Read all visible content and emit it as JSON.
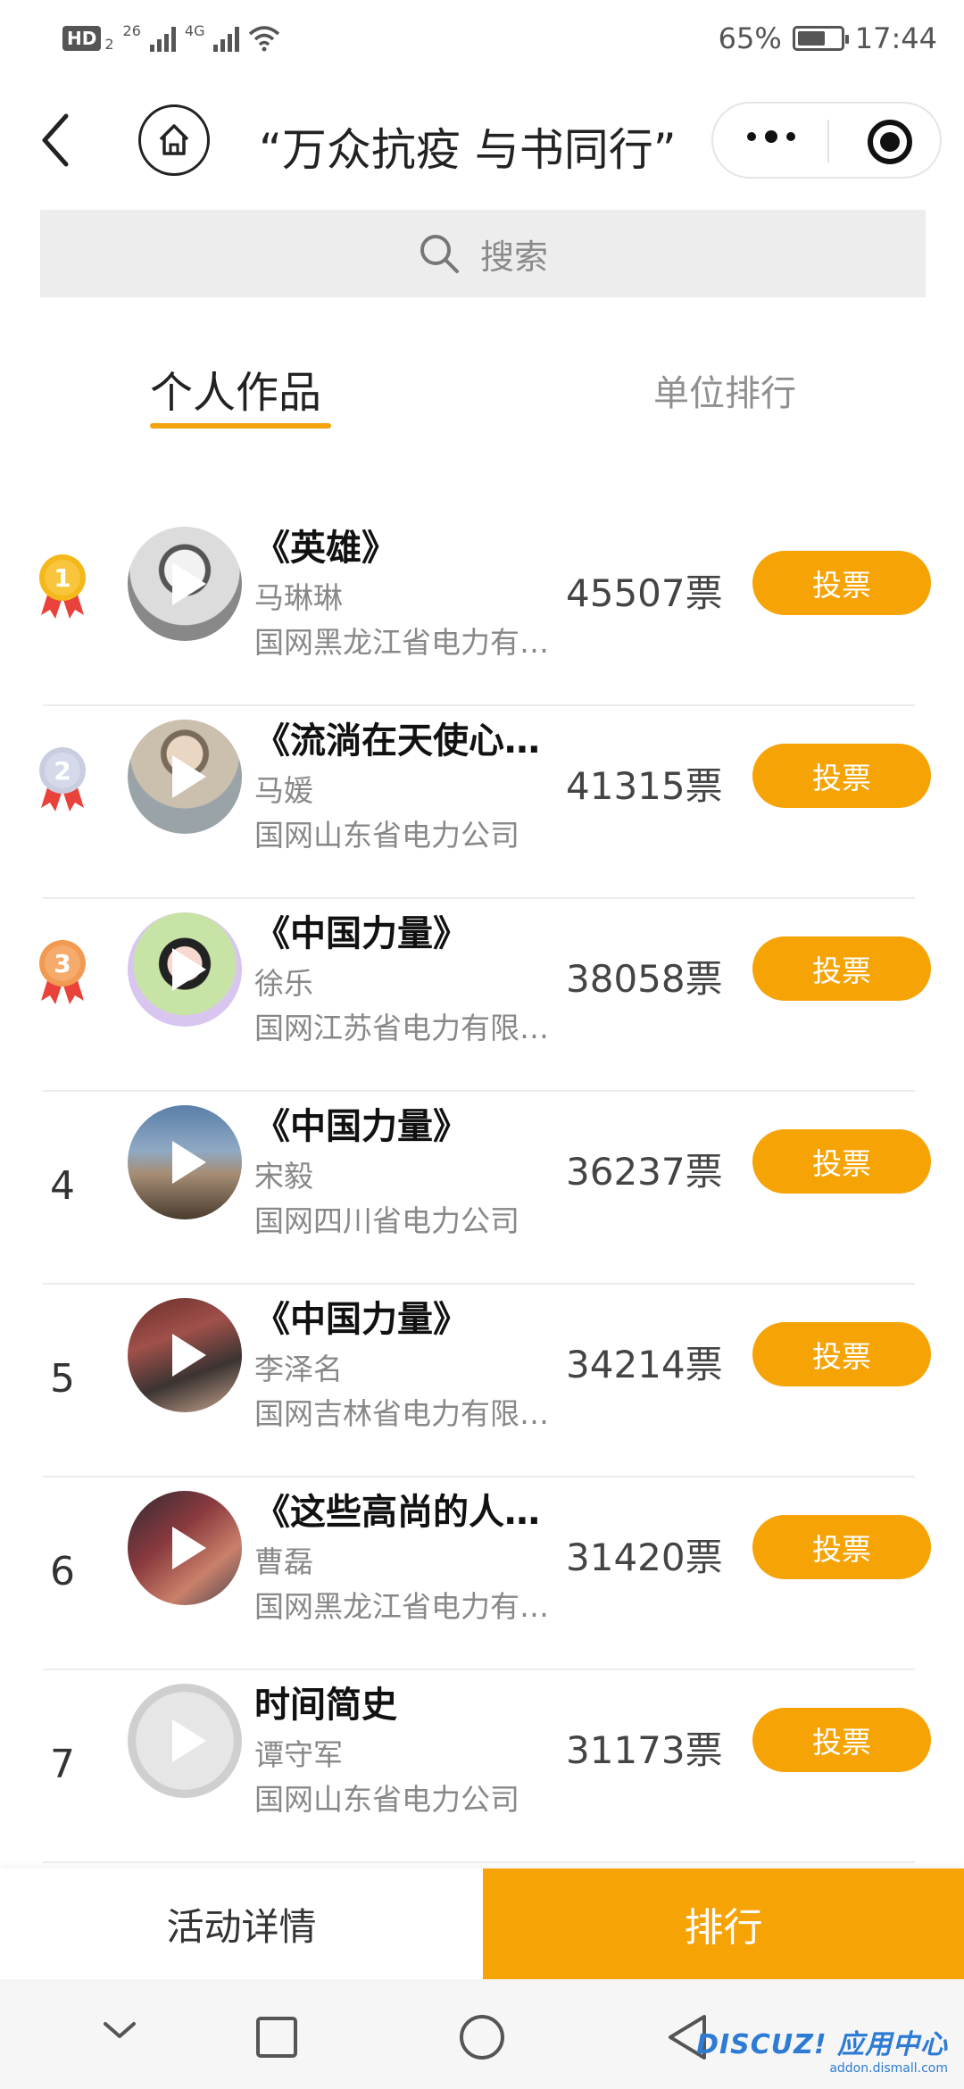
{
  "status_bar": {
    "hd": "HD",
    "hd_sub": "2",
    "net1": "26",
    "net2": "4G",
    "battery_percent": "65%",
    "battery_level": 0.65,
    "time": "17:44"
  },
  "nav": {
    "title": "“万众抗疫 与书同行”"
  },
  "search": {
    "placeholder": "搜索"
  },
  "tabs": [
    {
      "label": "个人作品",
      "active": true
    },
    {
      "label": "单位排行",
      "active": false
    }
  ],
  "entries": [
    {
      "rank": "1",
      "medal_color": "#f5b81b",
      "title": "《英雄》",
      "author": "马琳琳",
      "org": "国网黑龙江省电力有…",
      "votes": "45507票",
      "button": "投票"
    },
    {
      "rank": "2",
      "medal_color": "#c9cde0",
      "title": "《流淌在天使心…",
      "author": "马媛",
      "org": "国网山东省电力公司",
      "votes": "41315票",
      "button": "投票"
    },
    {
      "rank": "3",
      "medal_color": "#f29a52",
      "title": "《中国力量》",
      "author": "徐乐",
      "org": "国网江苏省电力有限…",
      "votes": "38058票",
      "button": "投票"
    },
    {
      "rank": "4",
      "title": "《中国力量》",
      "author": "宋毅",
      "org": "国网四川省电力公司",
      "votes": "36237票",
      "button": "投票"
    },
    {
      "rank": "5",
      "title": "《中国力量》",
      "author": "李泽名",
      "org": "国网吉林省电力有限…",
      "votes": "34214票",
      "button": "投票"
    },
    {
      "rank": "6",
      "title": "《这些高尚的人…",
      "author": "曹磊",
      "org": "国网黑龙江省电力有…",
      "votes": "31420票",
      "button": "投票"
    },
    {
      "rank": "7",
      "title": "时间简史",
      "author": "谭守军",
      "org": "国网山东省电力公司",
      "votes": "31173票",
      "button": "投票"
    }
  ],
  "bottom_bar": {
    "detail_label": "活动详情",
    "rank_label": "排行"
  },
  "watermark": {
    "main": "DISCUZ! 应用中心",
    "sub": "addon.dismall.com"
  },
  "colors": {
    "accent": "#f6a306",
    "tab_underline": "#f2a20c"
  }
}
